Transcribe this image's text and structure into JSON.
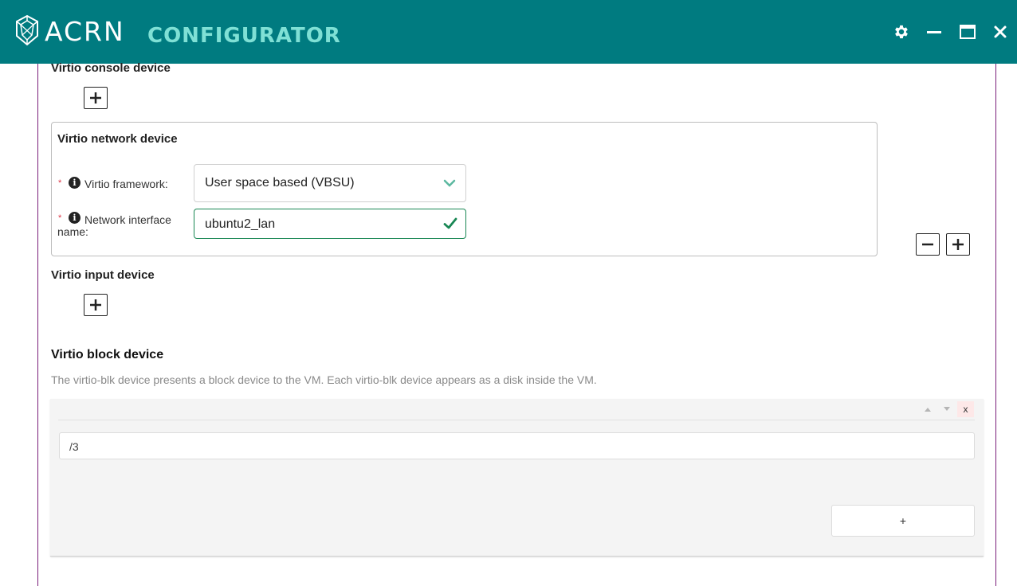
{
  "header": {
    "brand": "ACRN",
    "product": "CONFIGURATOR",
    "background": "#007b80",
    "controls": [
      "gear-icon",
      "minimize-icon",
      "maximize-icon",
      "close-icon"
    ]
  },
  "console": {
    "title": "Virtio console device"
  },
  "network": {
    "title": "Virtio network device",
    "framework_label": "Virtio framework:",
    "framework_value": "User space based (VBSU)",
    "iface_label_line1": "Network interface",
    "iface_label_line2": "name:",
    "iface_value": "ubuntu2_lan",
    "required_mark": "*"
  },
  "input": {
    "title": "Virtio input device"
  },
  "block": {
    "title": "Virtio block device",
    "description": "The virtio-blk device presents a block device to the VM. Each virtio-blk device appears as a disk inside the VM.",
    "remove_label": "x",
    "item_value": "/3",
    "add_label": "+"
  },
  "colors": {
    "accent": "#007b80",
    "accent_light": "#7fe0d5",
    "valid": "#198754",
    "required": "#dc3545",
    "frame": "#7a1f7a"
  }
}
